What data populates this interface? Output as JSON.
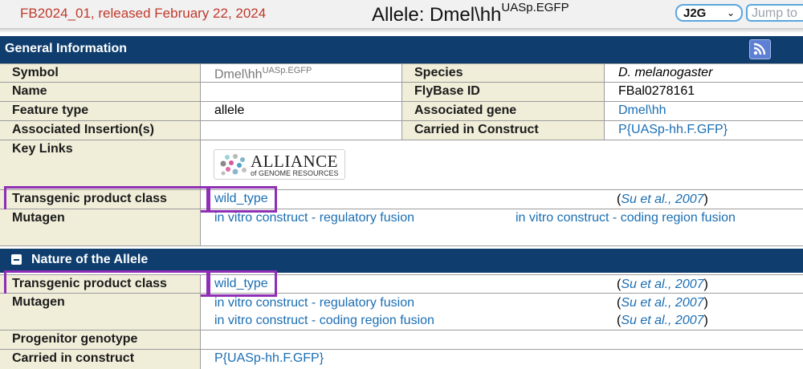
{
  "header": {
    "release": "FB2024_01, released February 22, 2024",
    "allele_title_base": "Allele: Dmel\\hh",
    "allele_title_sup": "UASp.EGFP",
    "site_select": "J2G",
    "jump_placeholder": "Jump to"
  },
  "general_info": {
    "title": "General Information",
    "symbol_label": "Symbol",
    "symbol_base": "Dmel\\hh",
    "symbol_sup": "UASp.EGFP",
    "species_label": "Species",
    "species_value": "D. melanogaster",
    "name_label": "Name",
    "name_value": "",
    "flybase_id_label": "FlyBase ID",
    "flybase_id_value": "FBal0278161",
    "feature_type_label": "Feature type",
    "feature_type_value": "allele",
    "associated_gene_label": "Associated gene",
    "associated_gene_value": "Dmel\\hh",
    "assoc_insertion_label": "Associated Insertion(s)",
    "assoc_insertion_value": "",
    "carried_in_construct_label": "Carried in Construct",
    "carried_in_construct_value": "P{UASp-hh.F.GFP}",
    "key_links_label": "Key Links",
    "alliance_logo_big": "ALLIANCE",
    "alliance_logo_small": "of GENOME RESOURCES",
    "transgenic_label": "Transgenic product class",
    "transgenic_value": "wild_type",
    "transgenic_ref_open": "(",
    "transgenic_ref": "Su et al., 2007",
    "transgenic_ref_close": ")",
    "mutagen_label": "Mutagen",
    "mutagen_values": [
      "in vitro construct - regulatory fusion",
      "in vitro construct - coding region fusion"
    ]
  },
  "nature": {
    "title": "Nature of the Allele",
    "transgenic_label": "Transgenic product class",
    "transgenic_value": "wild_type",
    "mutagen_label": "Mutagen",
    "mutagen_values": [
      "in vitro construct - regulatory fusion",
      "in vitro construct - coding region fusion"
    ],
    "ref_open": "(",
    "ref": "Su et al., 2007",
    "ref_close": ")",
    "progenitor_label": "Progenitor genotype",
    "progenitor_value": "",
    "carried_label": "Carried in construct",
    "carried_value": "P{UASp-hh.F.GFP}"
  },
  "colors": {
    "section_header": "#0f3e6e",
    "label_bg": "#f0edd8",
    "link": "#1a6eb3",
    "release_text": "#c0392b",
    "highlight": "#8e2fb6"
  },
  "icons": [
    "rss-icon",
    "collapse-icon",
    "chevron-down-icon",
    "alliance-logo"
  ]
}
